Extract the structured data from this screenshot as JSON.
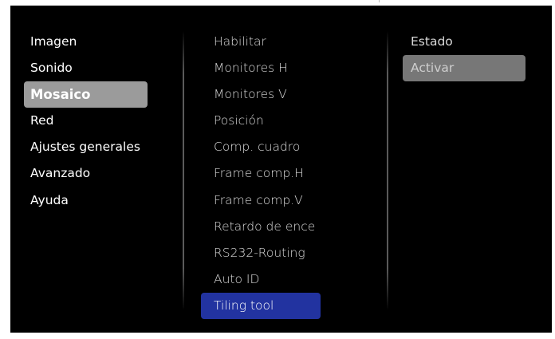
{
  "main_menu": {
    "items": [
      {
        "label": "Imagen"
      },
      {
        "label": "Sonido"
      },
      {
        "label": "Mosaico",
        "selected": true
      },
      {
        "label": "Red"
      },
      {
        "label": "Ajustes generales"
      },
      {
        "label": "Avanzado"
      },
      {
        "label": "Ayuda"
      }
    ]
  },
  "submenu": {
    "items": [
      {
        "label": "Habilitar"
      },
      {
        "label": "Monitores H"
      },
      {
        "label": "Monitores V"
      },
      {
        "label": "Posición"
      },
      {
        "label": "Comp. cuadro"
      },
      {
        "label": "Frame comp.H"
      },
      {
        "label": "Frame comp.V"
      },
      {
        "label": "Retardo de ence"
      },
      {
        "label": "RS232-Routing"
      },
      {
        "label": "Auto ID"
      },
      {
        "label": "Tiling tool",
        "highlighted": true
      }
    ]
  },
  "options": {
    "items": [
      {
        "label": "Estado"
      },
      {
        "label": "Activar",
        "selected": true
      }
    ]
  },
  "colors": {
    "background": "#000000",
    "main_selected": "#9b9b9b",
    "submenu_highlight": "#2233a0",
    "option_selected": "#777777",
    "divider": "#5a5a5a"
  }
}
